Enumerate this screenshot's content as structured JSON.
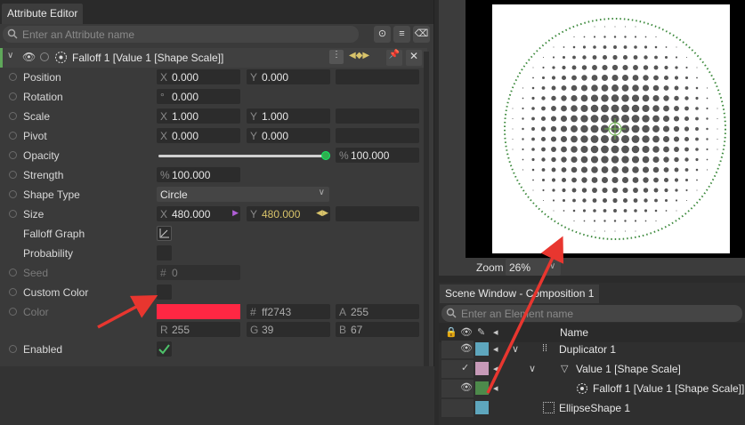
{
  "attr_editor": {
    "tab_title": "Attribute Editor",
    "search_placeholder": "Enter an Attribute name",
    "header_title": "Falloff 1 [Value 1 [Shape Scale]]",
    "rows": {
      "position": {
        "label": "Position",
        "x": "0.000",
        "y": "0.000"
      },
      "rotation": {
        "label": "Rotation",
        "v": "0.000"
      },
      "scale": {
        "label": "Scale",
        "x": "1.000",
        "y": "1.000"
      },
      "pivot": {
        "label": "Pivot",
        "x": "0.000",
        "y": "0.000"
      },
      "opacity": {
        "label": "Opacity",
        "v": "100.000"
      },
      "strength": {
        "label": "Strength",
        "v": "100.000"
      },
      "shape_type": {
        "label": "Shape Type",
        "v": "Circle"
      },
      "size": {
        "label": "Size",
        "x": "480.000",
        "y": "480.000"
      },
      "falloff_graph": {
        "label": "Falloff Graph"
      },
      "probability": {
        "label": "Probability"
      },
      "seed": {
        "label": "Seed",
        "v": "0"
      },
      "custom_color": {
        "label": "Custom Color"
      },
      "color": {
        "label": "Color",
        "hex": "ff2743",
        "a": "255",
        "r": "255",
        "g": "39",
        "b": "67",
        "swatch": "#ff2743"
      },
      "enabled": {
        "label": "Enabled"
      }
    },
    "prefixes": {
      "x": "X",
      "y": "Y",
      "deg": "°",
      "pct": "%",
      "hash": "#",
      "a": "A",
      "r": "R",
      "g": "G",
      "b": "B"
    }
  },
  "viewer": {
    "zoom_label": "Zoom",
    "zoom_value": "26%"
  },
  "scene": {
    "tab_title": "Scene Window - Composition 1",
    "search_placeholder": "Enter an Element name",
    "name_header": "Name",
    "items": [
      {
        "name": "Duplicator 1",
        "swatch": "#5ea6bd"
      },
      {
        "name": "Value 1 [Shape Scale]",
        "swatch": "#c79ab8"
      },
      {
        "name": "Falloff 1 [Value 1 [Shape Scale]]",
        "swatch": "#4d8a4b"
      },
      {
        "name": "EllipseShape 1",
        "swatch": "#5ea6bd"
      }
    ]
  },
  "colors": {
    "accent_green": "#5fa85a",
    "arrow_red": "#e8362f"
  }
}
